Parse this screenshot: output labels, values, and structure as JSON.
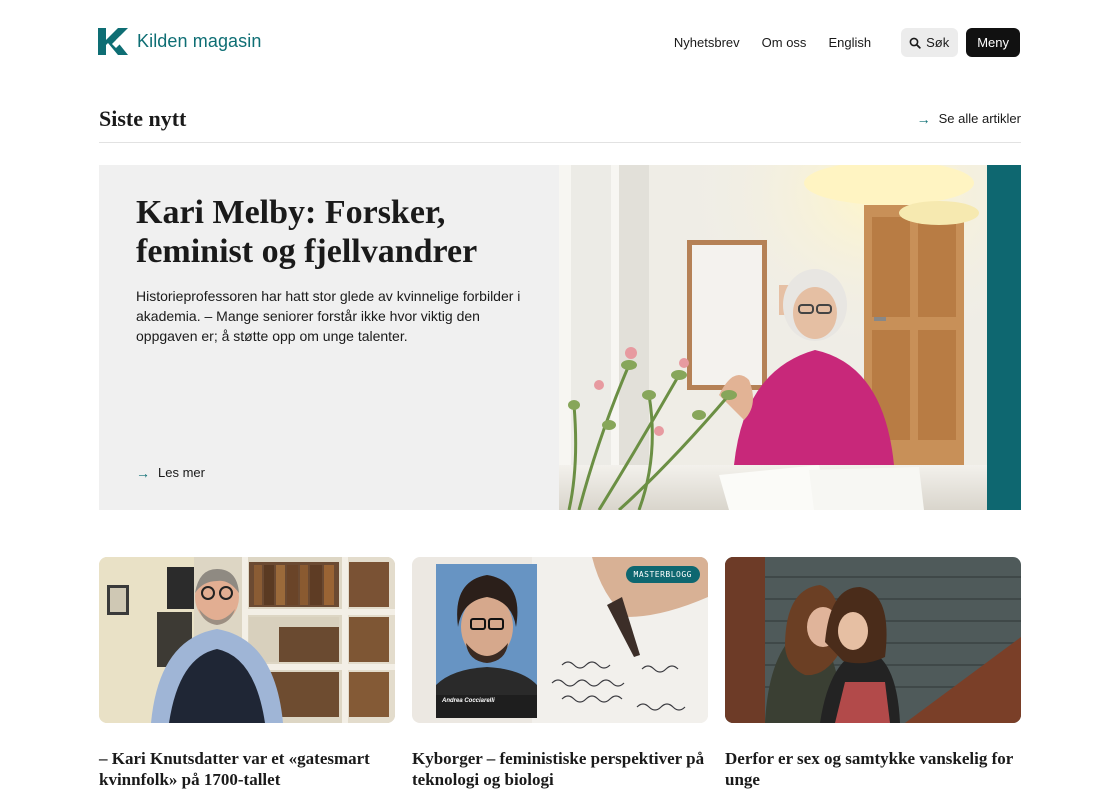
{
  "header": {
    "logo_text": "Kilden magasin",
    "nav": [
      "Nyhetsbrev",
      "Om oss",
      "English"
    ],
    "search_label": "Søk",
    "menu_label": "Meny"
  },
  "section": {
    "title": "Siste nytt",
    "see_all_label": "Se alle artikler"
  },
  "hero": {
    "title": "Kari Melby: Forsker, feminist og fjellvandrer",
    "description": "Historieprofessoren har hatt stor glede av kvinnelige forbilder i akademia. – Mange seniorer forstår ikke hvor viktig den oppgaven er; å støtte opp om unge talenter.",
    "read_more_label": "Les mer"
  },
  "cards": [
    {
      "title": "– Kari Knutsdatter var et «gatesmart kvinnfolk» på 1700-tallet"
    },
    {
      "title": "Kyborger – feministiske perspektiver på teknologi og biologi",
      "badge": "MASTERBLOGG",
      "photo_caption": "Andrea Cocciarelli"
    },
    {
      "title": "Derfor er sex og samtykke vanskelig for unge"
    }
  ],
  "colors": {
    "brand": "#0e6e74",
    "accent_bar": "#0e6770",
    "hero_bg": "#f0f0f0",
    "menu_button": "#111111"
  }
}
